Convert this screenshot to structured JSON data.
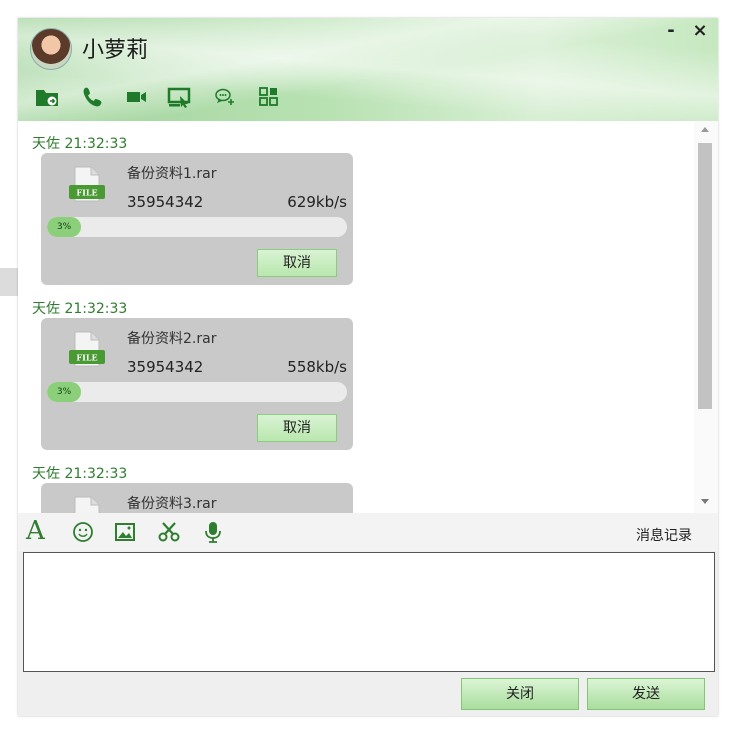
{
  "header": {
    "contact_name": "小萝莉",
    "min_label": "-",
    "close_label": "×"
  },
  "toolbar": {
    "buttons": [
      "send-file",
      "voice-call",
      "video-call",
      "screen-share",
      "add-chat",
      "apps"
    ]
  },
  "messages": [
    {
      "sender_time": "天佐 21:32:33",
      "file_name": "备份资料1.rar",
      "file_size": "35954342",
      "speed": "629kb/s",
      "progress_label": "3%",
      "progress": 0.03,
      "cancel_label": "取消"
    },
    {
      "sender_time": "天佐 21:32:33",
      "file_name": "备份资料2.rar",
      "file_size": "35954342",
      "speed": "558kb/s",
      "progress_label": "3%",
      "progress": 0.03,
      "cancel_label": "取消"
    },
    {
      "sender_time": "天佐 21:32:33",
      "file_name": "备份资料3.rar"
    }
  ],
  "file_icon_label": "FILE",
  "input_toolbar": {
    "font_icon_text": "A",
    "history_label": "消息记录"
  },
  "input": {
    "value": ""
  },
  "footer": {
    "close_label": "关闭",
    "send_label": "发送"
  },
  "colors": {
    "accent": "#2f7d2f",
    "button_green": "#b9e7af",
    "titlebar": "#b9e2b3"
  }
}
